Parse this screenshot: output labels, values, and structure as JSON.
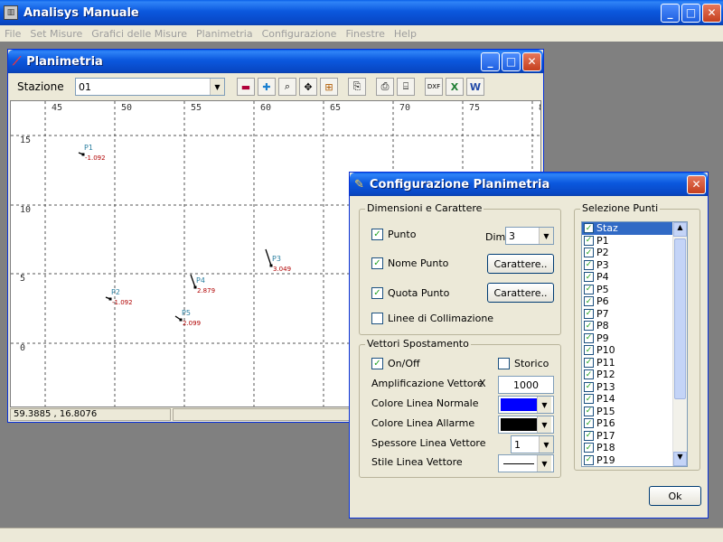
{
  "app": {
    "title": "Analisys Manuale"
  },
  "menu": [
    "File",
    "Set Misure",
    "Grafici delle Misure",
    "Planimetria",
    "Configurazione",
    "Finestre",
    "Help"
  ],
  "plan_window": {
    "title": "Planimetria",
    "station_label": "Stazione",
    "station_value": "01",
    "coords": "59.3885 , 16.8076"
  },
  "chart_data": {
    "type": "scatter",
    "x_ticks": [
      "45",
      "50",
      "55",
      "60",
      "65",
      "70",
      "75",
      "8"
    ],
    "y_ticks": [
      "15",
      "10",
      "5",
      "0"
    ],
    "points": [
      {
        "name": "P1",
        "value": "-1.092"
      },
      {
        "name": "P2",
        "value": "-1.092"
      },
      {
        "name": "P3",
        "value": "3.049"
      },
      {
        "name": "P4",
        "value": "2.879"
      },
      {
        "name": "P5",
        "value": "2.099"
      }
    ]
  },
  "config_dialog": {
    "title": "Configurazione Planimetria",
    "group_dim": "Dimensioni e Carattere",
    "punto_label": "Punto",
    "dim_label": "Dim.",
    "dim_value": "3",
    "nome_label": "Nome Punto",
    "quota_label": "Quota Punto",
    "carattere_label": "Carattere..",
    "linee_label": "Linee di Collimazione",
    "group_vett": "Vettori Spostamento",
    "onoff_label": "On/Off",
    "storico_label": "Storico",
    "ampl_label": "Amplificazione Vettore",
    "x_label": "X",
    "ampl_value": "1000",
    "colore_normale_label": "Colore Linea Normale",
    "colore_normale": "#0000ff",
    "colore_allarme_label": "Colore Linea Allarme",
    "colore_allarme": "#000000",
    "spessore_label": "Spessore Linea Vettore",
    "spessore_value": "1",
    "stile_label": "Stile Linea Vettore",
    "group_sel": "Selezione Punti",
    "points": [
      "Staz",
      "P1",
      "P2",
      "P3",
      "P4",
      "P5",
      "P6",
      "P7",
      "P8",
      "P9",
      "P10",
      "P11",
      "P12",
      "P13",
      "P14",
      "P15",
      "P16",
      "P17",
      "P18",
      "P19"
    ],
    "ok_label": "Ok"
  }
}
